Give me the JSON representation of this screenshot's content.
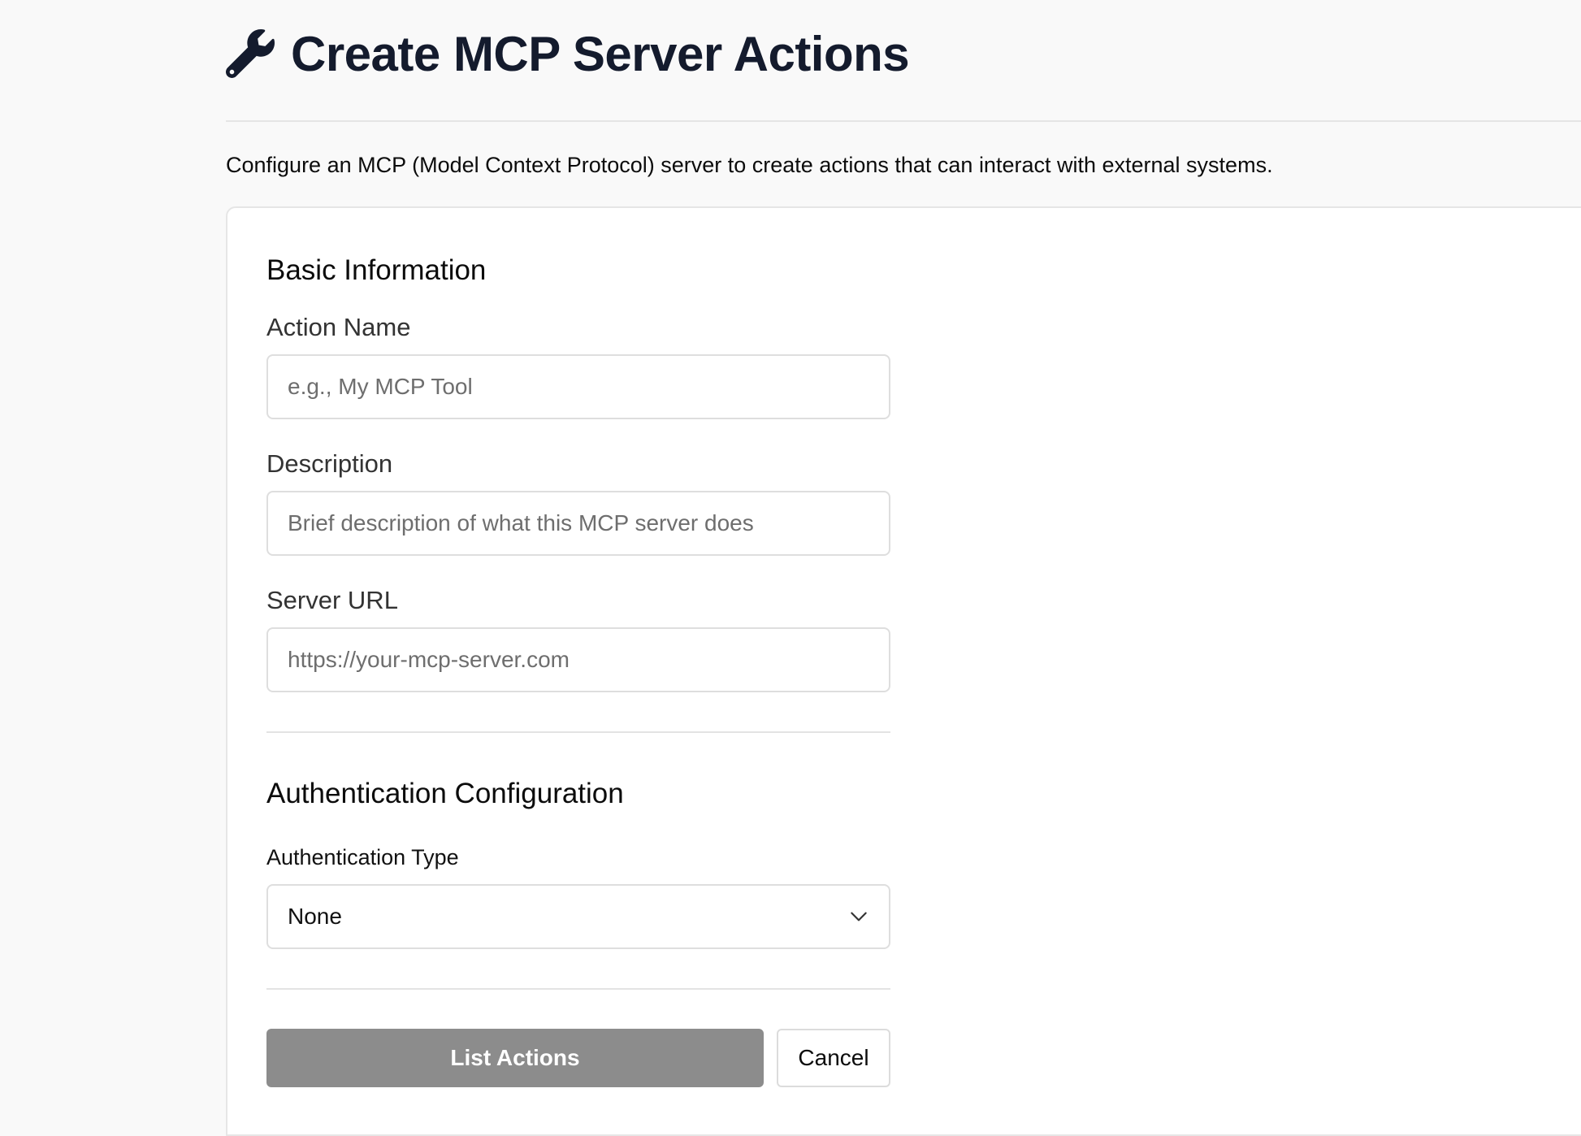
{
  "header": {
    "icon": "wrench-icon",
    "title": "Create MCP Server Actions"
  },
  "intro": "Configure an MCP (Model Context Protocol) server to create actions that can interact with external systems.",
  "basic_info": {
    "section_title": "Basic Information",
    "action_name": {
      "label": "Action Name",
      "value": "",
      "placeholder": "e.g., My MCP Tool"
    },
    "description": {
      "label": "Description",
      "value": "",
      "placeholder": "Brief description of what this MCP server does"
    },
    "server_url": {
      "label": "Server URL",
      "value": "",
      "placeholder": "https://your-mcp-server.com"
    }
  },
  "auth": {
    "section_title": "Authentication Configuration",
    "type_label": "Authentication Type",
    "selected": "None",
    "icon": "chevron-down-icon"
  },
  "buttons": {
    "list_actions": "List Actions",
    "cancel": "Cancel"
  },
  "colors": {
    "title": "#141b2d",
    "primary_button_disabled": "#8c8c8c",
    "background": "#f9f9f9",
    "card": "#ffffff",
    "border": "#dedede"
  }
}
